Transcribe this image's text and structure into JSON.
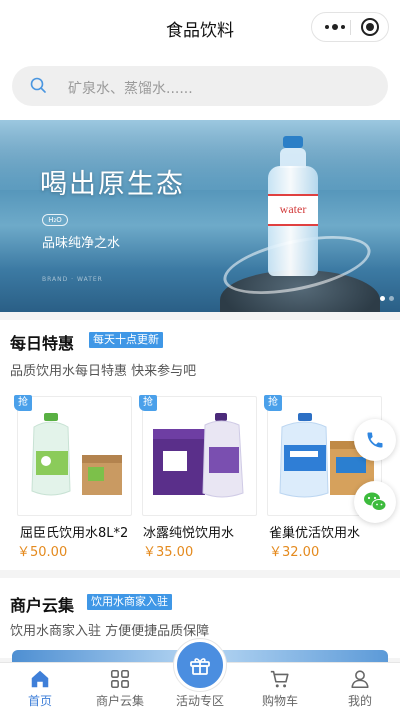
{
  "header": {
    "title": "食品饮料"
  },
  "search": {
    "placeholder": "矿泉水、蒸馏水......"
  },
  "banner": {
    "headline": "喝出原生态",
    "badge": "H₂O",
    "subtitle": "品味纯净之水",
    "fine_print": "BRAND · WATER",
    "bottle_label": "water"
  },
  "deals": {
    "title": "每日特惠",
    "tag": "每天十点更新",
    "description": "品质饮用水每日特惠 快来参与吧",
    "badge_label": "抢",
    "products": [
      {
        "name": "屈臣氏饮用水8L*2",
        "price": "￥50.00"
      },
      {
        "name": "冰露纯悦饮用水",
        "price": "￥35.00"
      },
      {
        "name": "雀巢优活饮用水",
        "price": "￥32.00"
      }
    ]
  },
  "merchants": {
    "title": "商户云集",
    "tag": "饮用水商家入驻",
    "description": "饮用水商家入驻 方便便捷品质保障"
  },
  "tabbar": {
    "items": [
      {
        "label": "首页",
        "icon": "home-icon",
        "active": true
      },
      {
        "label": "商户云集",
        "icon": "grid-icon",
        "active": false
      },
      {
        "label": "活动专区",
        "icon": "gift-icon",
        "active": false
      },
      {
        "label": "购物车",
        "icon": "cart-icon",
        "active": false
      },
      {
        "label": "我的",
        "icon": "user-icon",
        "active": false
      }
    ]
  },
  "colors": {
    "accent": "#3f97e6",
    "price": "#e48a1e",
    "active_tab": "#3f7fd8",
    "wechat": "#3dbb3d"
  }
}
